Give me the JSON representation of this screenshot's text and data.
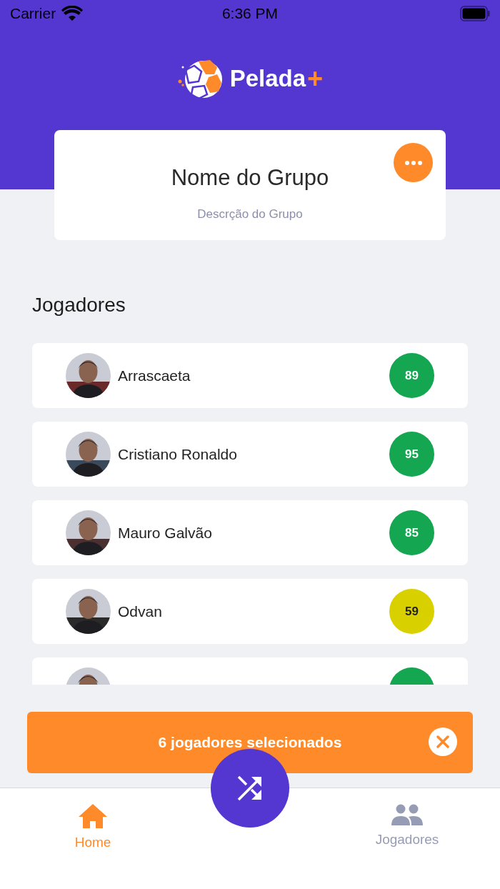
{
  "status_bar": {
    "carrier": "Carrier",
    "time": "6:36 PM"
  },
  "logo": {
    "text": "Pelada",
    "suffix": "+"
  },
  "group": {
    "name": "Nome do Grupo",
    "description": "Descrção do Grupo"
  },
  "section_title": "Jogadores",
  "players": [
    {
      "name": "Arrascaeta",
      "rating": "89",
      "color": "#14a651"
    },
    {
      "name": "Cristiano Ronaldo",
      "rating": "95",
      "color": "#14a651"
    },
    {
      "name": "Mauro Galvão",
      "rating": "85",
      "color": "#14a651"
    },
    {
      "name": "Odvan",
      "rating": "59",
      "color": "#d9d000"
    },
    {
      "color": "#14a651"
    }
  ],
  "selection_bar": {
    "text": "6 jogadores selecionados"
  },
  "tabs": [
    {
      "kind": "home",
      "label": "Home",
      "selected": true
    },
    {
      "kind": "people",
      "label": "Jogadores",
      "selected": false
    }
  ]
}
